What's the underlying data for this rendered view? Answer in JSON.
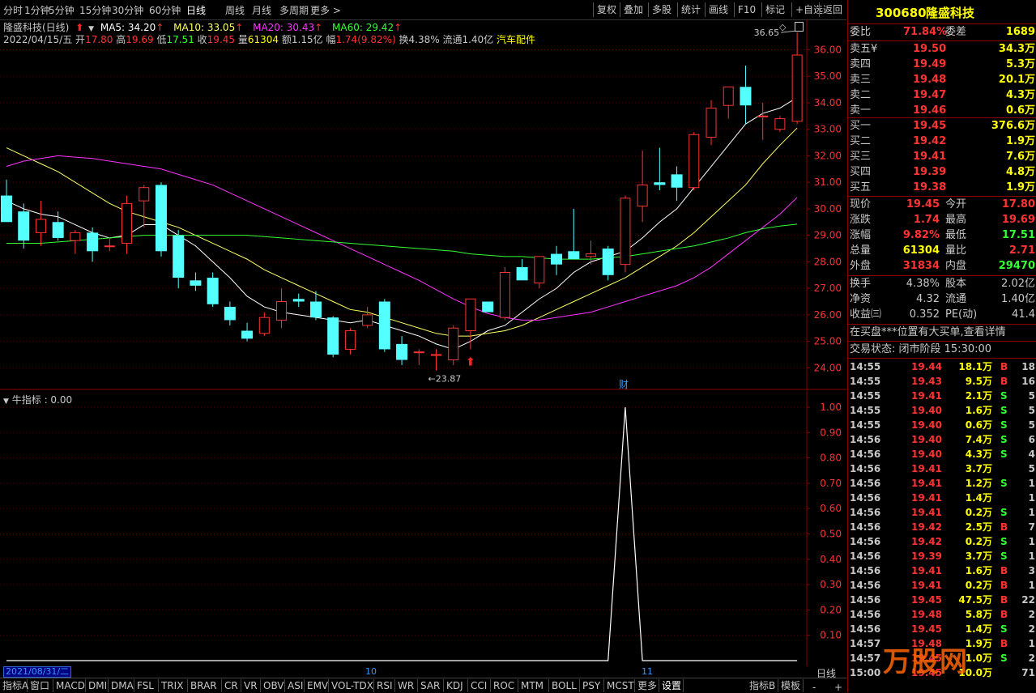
{
  "toolbar": {
    "periods": [
      "分时",
      "1分钟",
      "5分钟",
      "15分钟",
      "30分钟",
      "60分钟",
      "日线",
      "周线",
      "月线",
      "多周期",
      "更多 >"
    ],
    "active": "日线",
    "right": [
      "复权",
      "叠加",
      "多股",
      "统计",
      "画线",
      "F10",
      "标记",
      "+自选",
      "返回"
    ]
  },
  "chart_header": {
    "stock_label": "隆盛科技(日线)",
    "ma5": "MA5: 34.20",
    "ma10": "MA10: 33.05",
    "ma20": "MA20: 30.43",
    "ma60": "MA60: 29.42",
    "date": "2022/04/15/五",
    "open_l": "开",
    "open": "17.80",
    "high_l": "高",
    "high": "19.69",
    "low_l": "低",
    "low": "17.51",
    "close_l": "收",
    "close": "19.45",
    "vol_l": "量",
    "vol": "61304",
    "amt": "额1.15亿",
    "amp_l": "幅",
    "amp": "1.74(9.82%)",
    "turnover": "换4.38%",
    "float": "流通1.40亿",
    "sector": "汽车配件"
  },
  "chart_data": {
    "type": "candlestick",
    "price_axis": [
      "36.00",
      "35.00",
      "34.00",
      "33.00",
      "32.00",
      "31.00",
      "30.00",
      "29.00",
      "28.00",
      "27.00",
      "26.00",
      "25.00",
      "24.00"
    ],
    "ylim": [
      23.4,
      36.9
    ],
    "annotations": {
      "high_mark": "36.65",
      "low_mark": "23.87",
      "fin_marker": "财"
    },
    "candles": [
      {
        "o": 30.5,
        "h": 31.1,
        "l": 29.6,
        "c": 29.5
      },
      {
        "o": 29.9,
        "h": 30.2,
        "l": 28.5,
        "c": 28.8
      },
      {
        "o": 29.1,
        "h": 30.3,
        "l": 28.6,
        "c": 29.6
      },
      {
        "o": 29.5,
        "h": 29.9,
        "l": 28.8,
        "c": 28.9
      },
      {
        "o": 28.8,
        "h": 29.2,
        "l": 28.3,
        "c": 29.1
      },
      {
        "o": 29.1,
        "h": 29.3,
        "l": 28.0,
        "c": 28.4
      },
      {
        "o": 28.6,
        "h": 28.9,
        "l": 28.4,
        "c": 28.6
      },
      {
        "o": 28.7,
        "h": 30.5,
        "l": 28.3,
        "c": 30.2
      },
      {
        "o": 30.3,
        "h": 30.9,
        "l": 29.3,
        "c": 30.8
      },
      {
        "o": 30.9,
        "h": 31.0,
        "l": 28.2,
        "c": 28.4
      },
      {
        "o": 29.0,
        "h": 29.2,
        "l": 27.0,
        "c": 27.4
      },
      {
        "o": 27.3,
        "h": 27.6,
        "l": 26.9,
        "c": 27.1
      },
      {
        "o": 27.4,
        "h": 27.6,
        "l": 26.3,
        "c": 26.4
      },
      {
        "o": 26.3,
        "h": 26.5,
        "l": 25.6,
        "c": 25.8
      },
      {
        "o": 25.4,
        "h": 25.7,
        "l": 25.0,
        "c": 25.1
      },
      {
        "o": 25.3,
        "h": 26.1,
        "l": 25.2,
        "c": 25.9
      },
      {
        "o": 25.8,
        "h": 27.0,
        "l": 25.5,
        "c": 26.5
      },
      {
        "o": 26.6,
        "h": 26.8,
        "l": 26.3,
        "c": 26.5
      },
      {
        "o": 26.5,
        "h": 26.9,
        "l": 25.8,
        "c": 25.9
      },
      {
        "o": 25.9,
        "h": 25.95,
        "l": 24.4,
        "c": 24.5
      },
      {
        "o": 24.7,
        "h": 25.5,
        "l": 24.5,
        "c": 25.4
      },
      {
        "o": 25.6,
        "h": 26.3,
        "l": 25.5,
        "c": 26.0
      },
      {
        "o": 26.5,
        "h": 26.6,
        "l": 24.6,
        "c": 24.7
      },
      {
        "o": 24.9,
        "h": 25.2,
        "l": 24.1,
        "c": 24.3
      },
      {
        "o": 24.6,
        "h": 24.7,
        "l": 24.1,
        "c": 24.6
      },
      {
        "o": 24.5,
        "h": 24.7,
        "l": 23.9,
        "c": 24.5
      },
      {
        "o": 24.3,
        "h": 25.6,
        "l": 24.1,
        "c": 25.5
      },
      {
        "o": 25.4,
        "h": 26.6,
        "l": 24.7,
        "c": 26.6
      },
      {
        "o": 26.5,
        "h": 26.5,
        "l": 26.1,
        "c": 26.1
      },
      {
        "o": 25.9,
        "h": 27.8,
        "l": 25.8,
        "c": 27.6
      },
      {
        "o": 27.8,
        "h": 28.1,
        "l": 27.4,
        "c": 27.3
      },
      {
        "o": 27.2,
        "h": 28.2,
        "l": 27.0,
        "c": 28.2
      },
      {
        "o": 28.3,
        "h": 28.6,
        "l": 27.5,
        "c": 27.9
      },
      {
        "o": 28.4,
        "h": 30.0,
        "l": 28.2,
        "c": 28.1
      },
      {
        "o": 28.2,
        "h": 28.8,
        "l": 27.9,
        "c": 28.3
      },
      {
        "o": 28.5,
        "h": 28.6,
        "l": 27.3,
        "c": 27.5
      },
      {
        "o": 27.9,
        "h": 30.5,
        "l": 27.6,
        "c": 30.4
      },
      {
        "o": 30.1,
        "h": 32.2,
        "l": 29.5,
        "c": 30.9
      },
      {
        "o": 31.0,
        "h": 32.3,
        "l": 30.7,
        "c": 30.9
      },
      {
        "o": 31.3,
        "h": 31.6,
        "l": 30.3,
        "c": 30.8
      },
      {
        "o": 30.8,
        "h": 32.9,
        "l": 30.7,
        "c": 32.8
      },
      {
        "o": 32.7,
        "h": 34.1,
        "l": 32.4,
        "c": 33.8
      },
      {
        "o": 33.9,
        "h": 34.6,
        "l": 33.4,
        "c": 34.6
      },
      {
        "o": 34.6,
        "h": 35.4,
        "l": 33.2,
        "c": 33.9
      },
      {
        "o": 33.5,
        "h": 34.0,
        "l": 32.6,
        "c": 33.5
      },
      {
        "o": 33.0,
        "h": 33.5,
        "l": 32.9,
        "c": 33.4
      },
      {
        "o": 33.3,
        "h": 36.65,
        "l": 33.2,
        "c": 35.8
      }
    ],
    "ma_lines": [
      {
        "name": "MA5",
        "color": "#ffffff",
        "values": [
          30.3,
          30.0,
          29.8,
          29.7,
          29.4,
          29.1,
          28.9,
          29.0,
          29.4,
          29.4,
          29.0,
          28.6,
          28.0,
          27.4,
          26.7,
          26.3,
          26.1,
          26.0,
          25.9,
          25.8,
          25.7,
          25.8,
          25.6,
          25.4,
          25.2,
          24.9,
          24.7,
          25.0,
          25.4,
          25.6,
          26.1,
          26.6,
          27.0,
          27.6,
          28.0,
          28.2,
          28.4,
          28.9,
          29.5,
          30.0,
          30.8,
          31.6,
          32.4,
          33.2,
          33.6,
          33.8,
          34.2
        ]
      },
      {
        "name": "MA10",
        "color": "#ffff66",
        "values": [
          32.3,
          32.0,
          31.7,
          31.4,
          31.0,
          30.6,
          30.2,
          29.9,
          29.7,
          29.5,
          29.3,
          29.0,
          28.7,
          28.4,
          28.1,
          27.7,
          27.4,
          27.1,
          26.8,
          26.5,
          26.2,
          26.1,
          25.9,
          25.7,
          25.5,
          25.3,
          25.2,
          25.2,
          25.3,
          25.4,
          25.6,
          25.9,
          26.2,
          26.5,
          26.8,
          27.1,
          27.4,
          27.8,
          28.2,
          28.6,
          29.1,
          29.7,
          30.3,
          30.9,
          31.7,
          32.4,
          33.05
        ]
      },
      {
        "name": "MA20",
        "color": "#ff33ff",
        "values": [
          31.6,
          31.8,
          31.9,
          32.0,
          31.95,
          31.9,
          31.8,
          31.7,
          31.6,
          31.5,
          31.3,
          31.1,
          30.9,
          30.6,
          30.3,
          30.0,
          29.7,
          29.4,
          29.1,
          28.8,
          28.5,
          28.2,
          27.9,
          27.6,
          27.3,
          26.95,
          26.6,
          26.3,
          26.05,
          25.9,
          25.8,
          25.8,
          25.9,
          26.0,
          26.1,
          26.3,
          26.5,
          26.7,
          26.9,
          27.1,
          27.4,
          27.8,
          28.3,
          28.8,
          29.3,
          29.8,
          30.43
        ]
      },
      {
        "name": "MA60",
        "color": "#33ff33",
        "values": [
          28.7,
          28.7,
          28.7,
          28.75,
          28.8,
          28.85,
          28.9,
          28.95,
          29.0,
          29.0,
          29.0,
          29.0,
          29.0,
          29.0,
          29.0,
          28.95,
          28.9,
          28.85,
          28.8,
          28.75,
          28.7,
          28.65,
          28.6,
          28.55,
          28.5,
          28.45,
          28.4,
          28.3,
          28.25,
          28.2,
          28.2,
          28.15,
          28.1,
          28.1,
          28.1,
          28.15,
          28.2,
          28.3,
          28.4,
          28.5,
          28.6,
          28.75,
          28.9,
          29.1,
          29.25,
          29.35,
          29.42
        ]
      }
    ],
    "indicator": {
      "name": "牛指标",
      "value_label": "牛指标 : 0.00",
      "axis": [
        "1.00",
        "0.90",
        "0.80",
        "0.70",
        "0.60",
        "0.50",
        "0.40",
        "0.30",
        "0.20",
        "0.10"
      ],
      "ylim": [
        0,
        1
      ],
      "values": [
        0,
        0,
        0,
        0,
        0,
        0,
        0,
        0,
        0,
        0,
        0,
        0,
        0,
        0,
        0,
        0,
        0,
        0,
        0,
        0,
        0,
        0,
        0,
        0,
        0,
        0,
        0,
        0,
        0,
        0,
        0,
        0,
        0,
        0,
        0,
        0,
        1,
        0,
        0,
        0,
        0,
        0,
        0,
        0,
        0,
        0,
        0
      ]
    },
    "date_axis": {
      "start": "2021/08/31/二",
      "m10": "10",
      "m11": "11"
    }
  },
  "panel": {
    "code": "300680",
    "name": "隆盛科技",
    "webi_l": "委比",
    "webi": "71.84%",
    "weicha_l": "委差",
    "weicha": "1689",
    "asks": [
      {
        "label": "卖五",
        "price": "19.50",
        "vol": "34.3万"
      },
      {
        "label": "卖四",
        "price": "19.49",
        "vol": "5.3万"
      },
      {
        "label": "卖三",
        "price": "19.48",
        "vol": "20.1万"
      },
      {
        "label": "卖二",
        "price": "19.47",
        "vol": "4.3万"
      },
      {
        "label": "卖一",
        "price": "19.46",
        "vol": "0.6万"
      }
    ],
    "ask_mark": "¥",
    "bids": [
      {
        "label": "买一",
        "price": "19.45",
        "vol": "376.6万"
      },
      {
        "label": "买二",
        "price": "19.42",
        "vol": "1.9万"
      },
      {
        "label": "买三",
        "price": "19.41",
        "vol": "7.6万"
      },
      {
        "label": "买四",
        "price": "19.39",
        "vol": "4.8万"
      },
      {
        "label": "买五",
        "price": "19.38",
        "vol": "1.9万"
      }
    ],
    "quote": [
      {
        "l1": "现价",
        "v1": "19.45",
        "c1": "#ff3333",
        "l2": "今开",
        "v2": "17.80",
        "c2": "#ff3333"
      },
      {
        "l1": "涨跌",
        "v1": "1.74",
        "c1": "#ff3333",
        "l2": "最高",
        "v2": "19.69",
        "c2": "#ff3333"
      },
      {
        "l1": "涨幅",
        "v1": "9.82%",
        "c1": "#ff3333",
        "l2": "最低",
        "v2": "17.51",
        "c2": "#33ff33"
      },
      {
        "l1": "总量",
        "v1": "61304",
        "c1": "#ffff00",
        "l2": "量比",
        "v2": "2.71",
        "c2": "#ff3333"
      },
      {
        "l1": "外盘",
        "v1": "31834",
        "c1": "#ff3333",
        "l2": "内盘",
        "v2": "29470",
        "c2": "#33ff33"
      }
    ],
    "fund": [
      {
        "l1": "换手",
        "v1": "4.38%",
        "l2": "股本",
        "v2": "2.02亿"
      },
      {
        "l1": "净资",
        "v1": "4.32",
        "l2": "流通",
        "v2": "1.40亿"
      },
      {
        "l1": "收益㈢",
        "v1": "0.352",
        "l2": "PE(动)",
        "v2": "41.4"
      }
    ],
    "notice": "在买盘***位置有大买单,查看详情",
    "status": "交易状态: 闭市阶段 15:30:00",
    "ticks": [
      {
        "t": "14:55",
        "p": "19.44",
        "v": "18.1万",
        "bs": "B",
        "n": "18"
      },
      {
        "t": "14:55",
        "p": "19.43",
        "v": "9.5万",
        "bs": "B",
        "n": "16"
      },
      {
        "t": "14:55",
        "p": "19.41",
        "v": "2.1万",
        "bs": "S",
        "n": "5"
      },
      {
        "t": "14:55",
        "p": "19.40",
        "v": "1.6万",
        "bs": "S",
        "n": "5"
      },
      {
        "t": "14:55",
        "p": "19.40",
        "v": "0.6万",
        "bs": "S",
        "n": "5"
      },
      {
        "t": "14:56",
        "p": "19.40",
        "v": "7.4万",
        "bs": "S",
        "n": "6"
      },
      {
        "t": "14:56",
        "p": "19.40",
        "v": "4.3万",
        "bs": "S",
        "n": "4"
      },
      {
        "t": "14:56",
        "p": "19.41",
        "v": "3.7万",
        "bs": "",
        "n": "5"
      },
      {
        "t": "14:56",
        "p": "19.41",
        "v": "1.2万",
        "bs": "S",
        "n": "1"
      },
      {
        "t": "14:56",
        "p": "19.41",
        "v": "1.4万",
        "bs": "",
        "n": "1"
      },
      {
        "t": "14:56",
        "p": "19.41",
        "v": "0.2万",
        "bs": "S",
        "n": "1"
      },
      {
        "t": "14:56",
        "p": "19.42",
        "v": "2.5万",
        "bs": "B",
        "n": "7"
      },
      {
        "t": "14:56",
        "p": "19.42",
        "v": "0.2万",
        "bs": "S",
        "n": "1"
      },
      {
        "t": "14:56",
        "p": "19.39",
        "v": "3.7万",
        "bs": "S",
        "n": "1"
      },
      {
        "t": "14:56",
        "p": "19.41",
        "v": "1.6万",
        "bs": "B",
        "n": "3"
      },
      {
        "t": "14:56",
        "p": "19.41",
        "v": "0.2万",
        "bs": "B",
        "n": "1"
      },
      {
        "t": "14:56",
        "p": "19.45",
        "v": "47.5万",
        "bs": "B",
        "n": "22"
      },
      {
        "t": "14:56",
        "p": "19.48",
        "v": "5.8万",
        "bs": "B",
        "n": "2"
      },
      {
        "t": "14:56",
        "p": "19.45",
        "v": "1.4万",
        "bs": "S",
        "n": "2"
      },
      {
        "t": "14:57",
        "p": "19.48",
        "v": "1.9万",
        "bs": "B",
        "n": "1"
      },
      {
        "t": "14:57",
        "p": "19.45",
        "v": "1.0万",
        "bs": "S",
        "n": "2"
      },
      {
        "t": "15:00",
        "p": "19.45",
        "v": "10.0万",
        "bs": "",
        "n": "71"
      }
    ],
    "side_tab": "日线",
    "side_plus": "+",
    "side_minus": "-"
  },
  "bottom_tabs": [
    "指标A",
    "窗口",
    "MACD",
    "DMI",
    "DMA",
    "FSL",
    "TRIX",
    "BRAR",
    "CR",
    "VR",
    "OBV",
    "ASI",
    "EMV",
    "VOL-TDX",
    "RSI",
    "WR",
    "SAR",
    "KDJ",
    "CCI",
    "ROC",
    "MTM",
    "BOLL",
    "PSY",
    "MCST",
    "更多",
    "设置"
  ],
  "bottom_right": [
    "指标B",
    "模板"
  ],
  "watermark": "万股网"
}
